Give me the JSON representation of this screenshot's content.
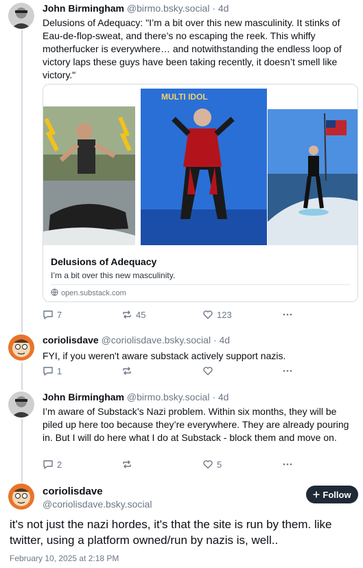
{
  "posts": [
    {
      "author": "John Birmingham",
      "handle": "@birmo.bsky.social",
      "age": "· 4d",
      "text": "Delusions of Adequacy: \"I’m a bit over this new masculinity. It stinks of Eau-de-flop-sweat, and there’s no escaping the reek. This whiffy motherfucker is everywhere… and notwithstanding the endless loop of victory laps these guys have been taking recently, it doesn’t smell like victory.\"",
      "embed": {
        "title": "Delusions of Adequacy",
        "description": "I’m a bit over this new masculinity.",
        "domain": "open.substack.com"
      },
      "replies": "7",
      "reposts": "45",
      "likes": "123"
    },
    {
      "author": "coriolisdave",
      "handle": "@coriolisdave.bsky.social",
      "age": "· 4d",
      "text": "FYI, if you weren't aware substack actively support nazis.",
      "replies": "1",
      "reposts": "",
      "likes": ""
    },
    {
      "author": "John Birmingham",
      "handle": "@birmo.bsky.social",
      "age": "· 4d",
      "text": "I’m aware of Substack’s Nazi problem. Within six months, they will be piled up here too because they’re everywhere. They are already pouring in. But I will do here what I do at Substack - block them and move on.",
      "replies": "2",
      "reposts": "",
      "likes": "5"
    }
  ],
  "focused": {
    "author": "coriolisdave",
    "handle": "@coriolisdave.bsky.social",
    "follow_label": "Follow",
    "text": "it's not just the nazi hordes, it's that the site is run by them. like twitter, using a platform owned/run by nazis is, well..",
    "timestamp": "February 10, 2025 at 2:18 PM"
  },
  "icons": {
    "reply": "speech-bubble-icon",
    "repost": "repost-arrows-icon",
    "like": "heart-icon",
    "more": "ellipsis-icon",
    "follow": "plus-icon",
    "domain": "globe-icon"
  },
  "colors": {
    "text": "#0b0f14",
    "muted": "#6b7785",
    "follow_bg": "#1f2a36",
    "thread_line": "#d4dbe2"
  }
}
